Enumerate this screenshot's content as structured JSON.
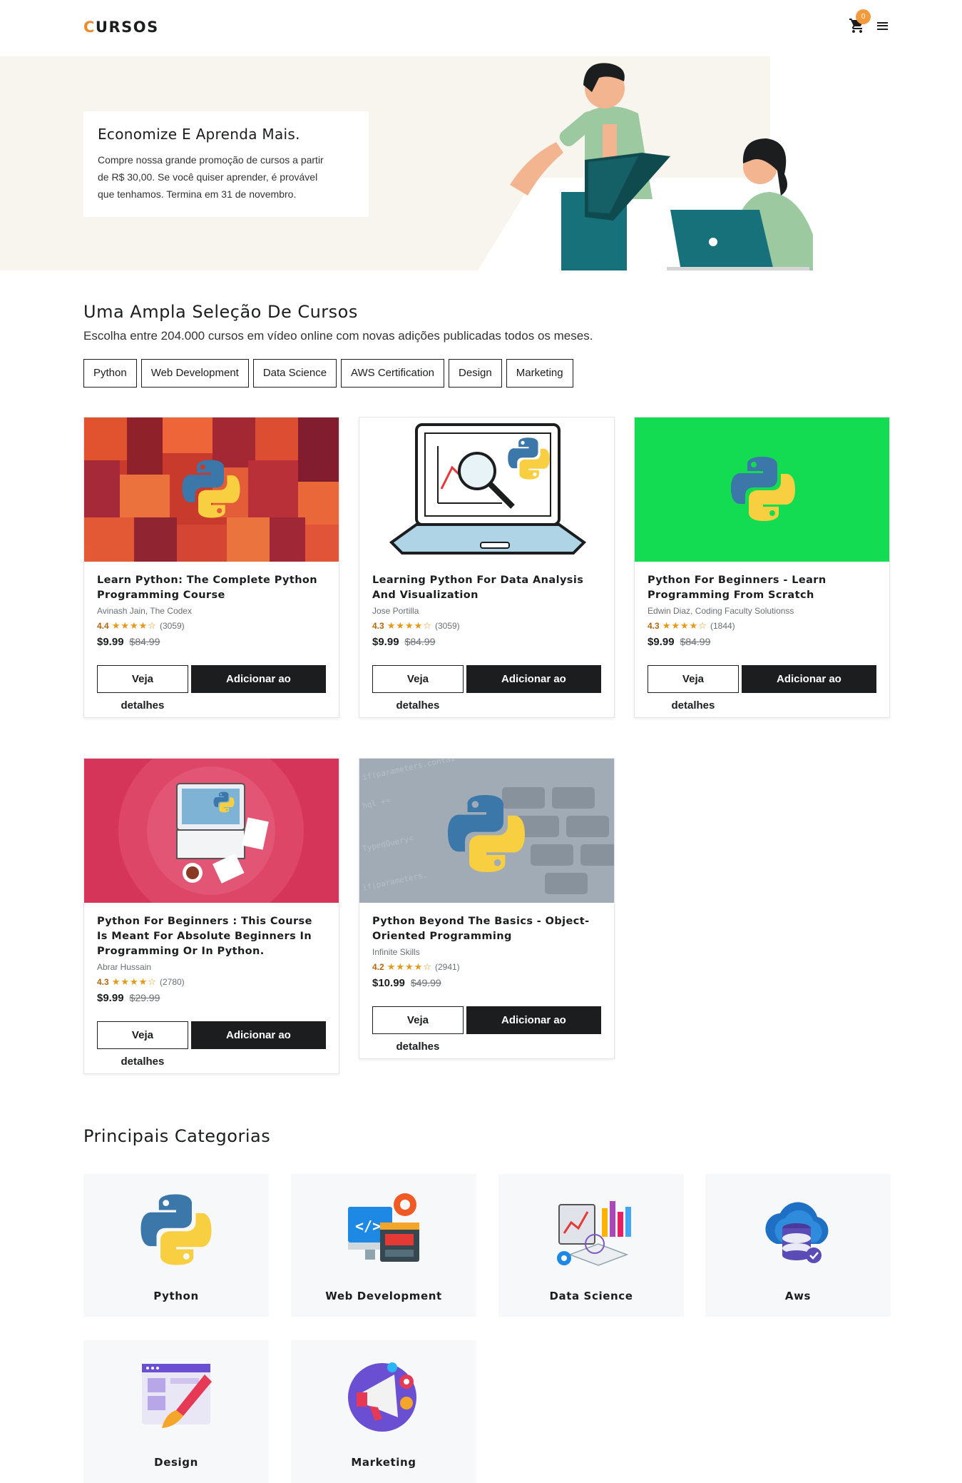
{
  "header": {
    "logo_first": "C",
    "logo_rest": "URSOS",
    "cart_count": "0",
    "accent_color": "#f29a3c"
  },
  "hero": {
    "title": "Economize E Aprenda Mais.",
    "text_line1": "Compre nossa grande promoção de cursos a partir",
    "text_line2": "de R$ 30,00. Se você quiser aprender, é provável",
    "text_line3": "que tenhamos. Termina em 31 de novembro."
  },
  "selection": {
    "title": "Uma Ampla Seleção De Cursos",
    "subtitle": "Escolha entre 204.000 cursos em vídeo online com novas adições publicadas todos os meses.",
    "chips": [
      "Python",
      "Web Development",
      "Data Science",
      "AWS Certification",
      "Design",
      "Marketing"
    ]
  },
  "courses": [
    {
      "title": "Learn Python: The Complete Python Programming Course",
      "author": "Avinash Jain, The Codex",
      "rating": "4.4",
      "stars": "★★★★☆",
      "count": "(3059)",
      "price": "$9.99",
      "old_price": "$84.99",
      "details_label": "Veja detalhes",
      "cart_label": "Adicionar ao carrinho",
      "thumb": "red-mosaic-python-logo"
    },
    {
      "title": "Learning Python For Data Analysis And Visualization",
      "author": "Jose Portilla",
      "rating": "4.3",
      "stars": "★★★★☆",
      "count": "(3059)",
      "price": "$9.99",
      "old_price": "$84.99",
      "details_label": "Veja detalhes",
      "cart_label": "Adicionar ao carrinho",
      "thumb": "laptop-chart-python"
    },
    {
      "title": "Python For Beginners - Learn Programming From Scratch",
      "author": "Edwin Diaz, Coding Faculty Solutionss",
      "rating": "4.3",
      "stars": "★★★★☆",
      "count": "(1844)",
      "price": "$9.99",
      "old_price": "$84.99",
      "details_label": "Veja detalhes",
      "cart_label": "Adicionar ao carrinho",
      "thumb": "green-python-logo"
    },
    {
      "title": "Python For Beginners : This Course Is Meant For Absolute Beginners In Programming Or In Python.",
      "author": "Abrar Hussain",
      "rating": "4.3",
      "stars": "★★★★☆",
      "count": "(2780)",
      "price": "$9.99",
      "old_price": "$29.99",
      "details_label": "Veja detalhes",
      "cart_label": "Adicionar ao carrinho",
      "thumb": "pink-laptop-python"
    },
    {
      "title": "Python Beyond The Basics - Object-Oriented Programming",
      "author": "Infinite Skills",
      "rating": "4.2",
      "stars": "★★★★☆",
      "count": "(2941)",
      "price": "$10.99",
      "old_price": "$49.99",
      "details_label": "Veja detalhes",
      "cart_label": "Adicionar ao carrinho",
      "thumb": "keyboard-code-python"
    }
  ],
  "categories": {
    "title": "Principais Categorias",
    "items": [
      {
        "label": "Python",
        "icon": "python-icon"
      },
      {
        "label": "Web Development",
        "icon": "web-development-icon"
      },
      {
        "label": "Data Science",
        "icon": "data-science-icon"
      },
      {
        "label": "Aws",
        "icon": "aws-cloud-icon"
      },
      {
        "label": "Design",
        "icon": "design-icon"
      },
      {
        "label": "Marketing",
        "icon": "marketing-icon"
      }
    ]
  }
}
